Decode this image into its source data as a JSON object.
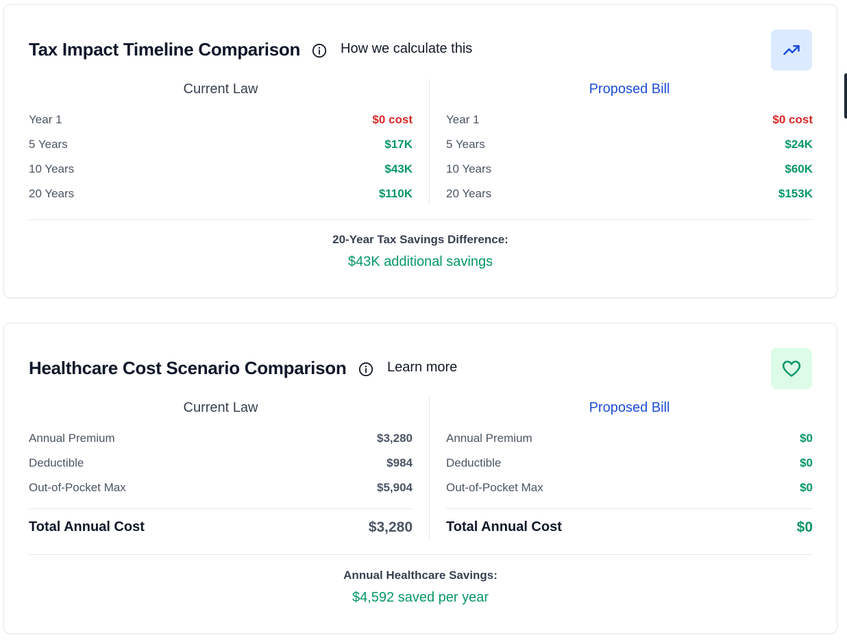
{
  "tax_card": {
    "title": "Tax Impact Timeline Comparison",
    "info_link": "How we calculate this",
    "badge_icon": "trending-up-icon",
    "current": {
      "heading": "Current Law",
      "rows": [
        {
          "label": "Year 1",
          "value": "$0 cost"
        },
        {
          "label": "5 Years",
          "value": "$17K"
        },
        {
          "label": "10 Years",
          "value": "$43K"
        },
        {
          "label": "20 Years",
          "value": "$110K"
        }
      ]
    },
    "proposed": {
      "heading": "Proposed Bill",
      "rows": [
        {
          "label": "Year 1",
          "value": "$0 cost"
        },
        {
          "label": "5 Years",
          "value": "$24K"
        },
        {
          "label": "10 Years",
          "value": "$60K"
        },
        {
          "label": "20 Years",
          "value": "$153K"
        }
      ]
    },
    "summary_label": "20-Year Tax Savings Difference:",
    "summary_value": "$43K additional savings"
  },
  "healthcare_card": {
    "title": "Healthcare Cost Scenario Comparison",
    "info_link": "Learn more",
    "badge_icon": "heart-icon",
    "current": {
      "heading": "Current Law",
      "rows": [
        {
          "label": "Annual Premium",
          "value": "$3,280"
        },
        {
          "label": "Deductible",
          "value": "$984"
        },
        {
          "label": "Out-of-Pocket Max",
          "value": "$5,904"
        }
      ],
      "total_label": "Total Annual Cost",
      "total_value": "$3,280"
    },
    "proposed": {
      "heading": "Proposed Bill",
      "rows": [
        {
          "label": "Annual Premium",
          "value": "$0"
        },
        {
          "label": "Deductible",
          "value": "$0"
        },
        {
          "label": "Out-of-Pocket Max",
          "value": "$0"
        }
      ],
      "total_label": "Total Annual Cost",
      "total_value": "$0"
    },
    "summary_label": "Annual Healthcare Savings:",
    "summary_value": "$4,592 saved per year"
  },
  "colors": {
    "cost_red": "#dc2626",
    "savings_green": "#059669",
    "proposed_blue": "#1d4ed8",
    "badge_blue_bg": "#dbeafe",
    "badge_green_bg": "#dcfce7"
  }
}
